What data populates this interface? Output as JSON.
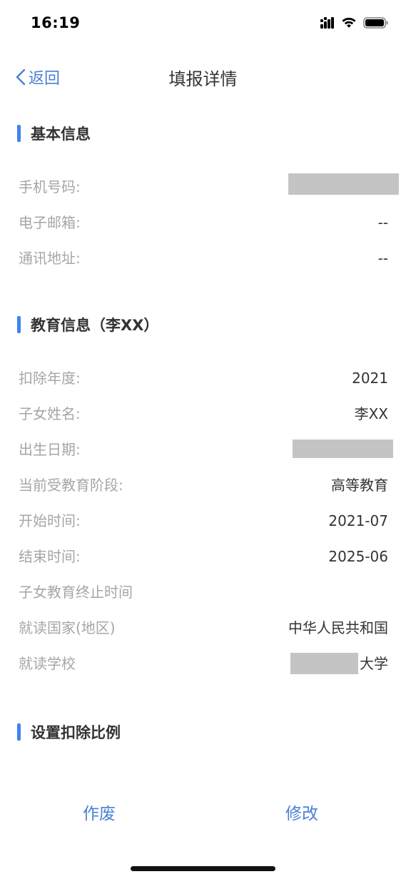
{
  "status_bar": {
    "time": "16:19",
    "icons": [
      "signal-icon",
      "wifi-icon",
      "battery-icon"
    ]
  },
  "nav": {
    "back_label": "返回",
    "title": "填报详情"
  },
  "sections": {
    "basic": {
      "title": "基本信息",
      "rows": [
        {
          "label": "手机号码:",
          "value": ""
        },
        {
          "label": "电子邮箱:",
          "value": "--"
        },
        {
          "label": "通讯地址:",
          "value": "--"
        }
      ]
    },
    "education": {
      "title": "教育信息（李XX）",
      "rows": [
        {
          "label": "扣除年度:",
          "value": "2021"
        },
        {
          "label": "子女姓名:",
          "value": "李XX"
        },
        {
          "label": "出生日期:",
          "value": ""
        },
        {
          "label": "当前受教育阶段:",
          "value": "高等教育"
        },
        {
          "label": "开始时间:",
          "value": "2021-07"
        },
        {
          "label": "结束时间:",
          "value": "2025-06"
        },
        {
          "label": "子女教育终止时间",
          "value": ""
        },
        {
          "label": "就读国家(地区)",
          "value": "中华人民共和国"
        },
        {
          "label": "就读学校",
          "value": "大学"
        }
      ]
    },
    "ratio": {
      "title": "设置扣除比例"
    }
  },
  "actions": {
    "void_label": "作废",
    "modify_label": "修改"
  },
  "colors": {
    "accent": "#3e82f0",
    "link": "#4a7fd6",
    "label": "#a6a6a6",
    "mask": "#c4c4c4"
  }
}
